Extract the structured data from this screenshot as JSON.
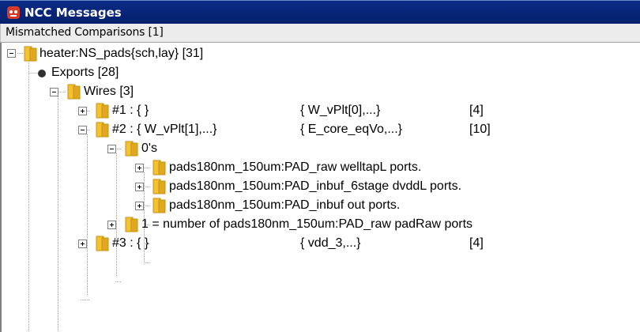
{
  "window": {
    "title": "NCC Messages",
    "tab_label": "Mismatched Comparisons [1]"
  },
  "tree": {
    "root": "heater:NS_pads{sch,lay} [31]",
    "exports": "Exports [28]",
    "wires": "Wires [3]",
    "wire1": {
      "label": "#1 : { }",
      "layout": "{ W_vPlt[0],...}",
      "count": "[4]"
    },
    "wire2": {
      "label": "#2 : { W_vPlt[1],...}",
      "layout": "{ E_core_eqVo,...}",
      "count": "[10]"
    },
    "zeros": "0's",
    "port1": "pads180nm_150um:PAD_raw welltapL ports.",
    "port2": "pads180nm_150um:PAD_inbuf_6stage dvddL ports.",
    "port3": "pads180nm_150um:PAD_inbuf out ports.",
    "one": "1 = number of pads180nm_150um:PAD_raw padRaw ports",
    "wire3": {
      "label": "#3 : { }",
      "layout": "{ vdd_3,...}",
      "count": "[4]"
    }
  },
  "colors": {
    "titlebar": "#0a2a84",
    "folder": "#f2c232"
  }
}
